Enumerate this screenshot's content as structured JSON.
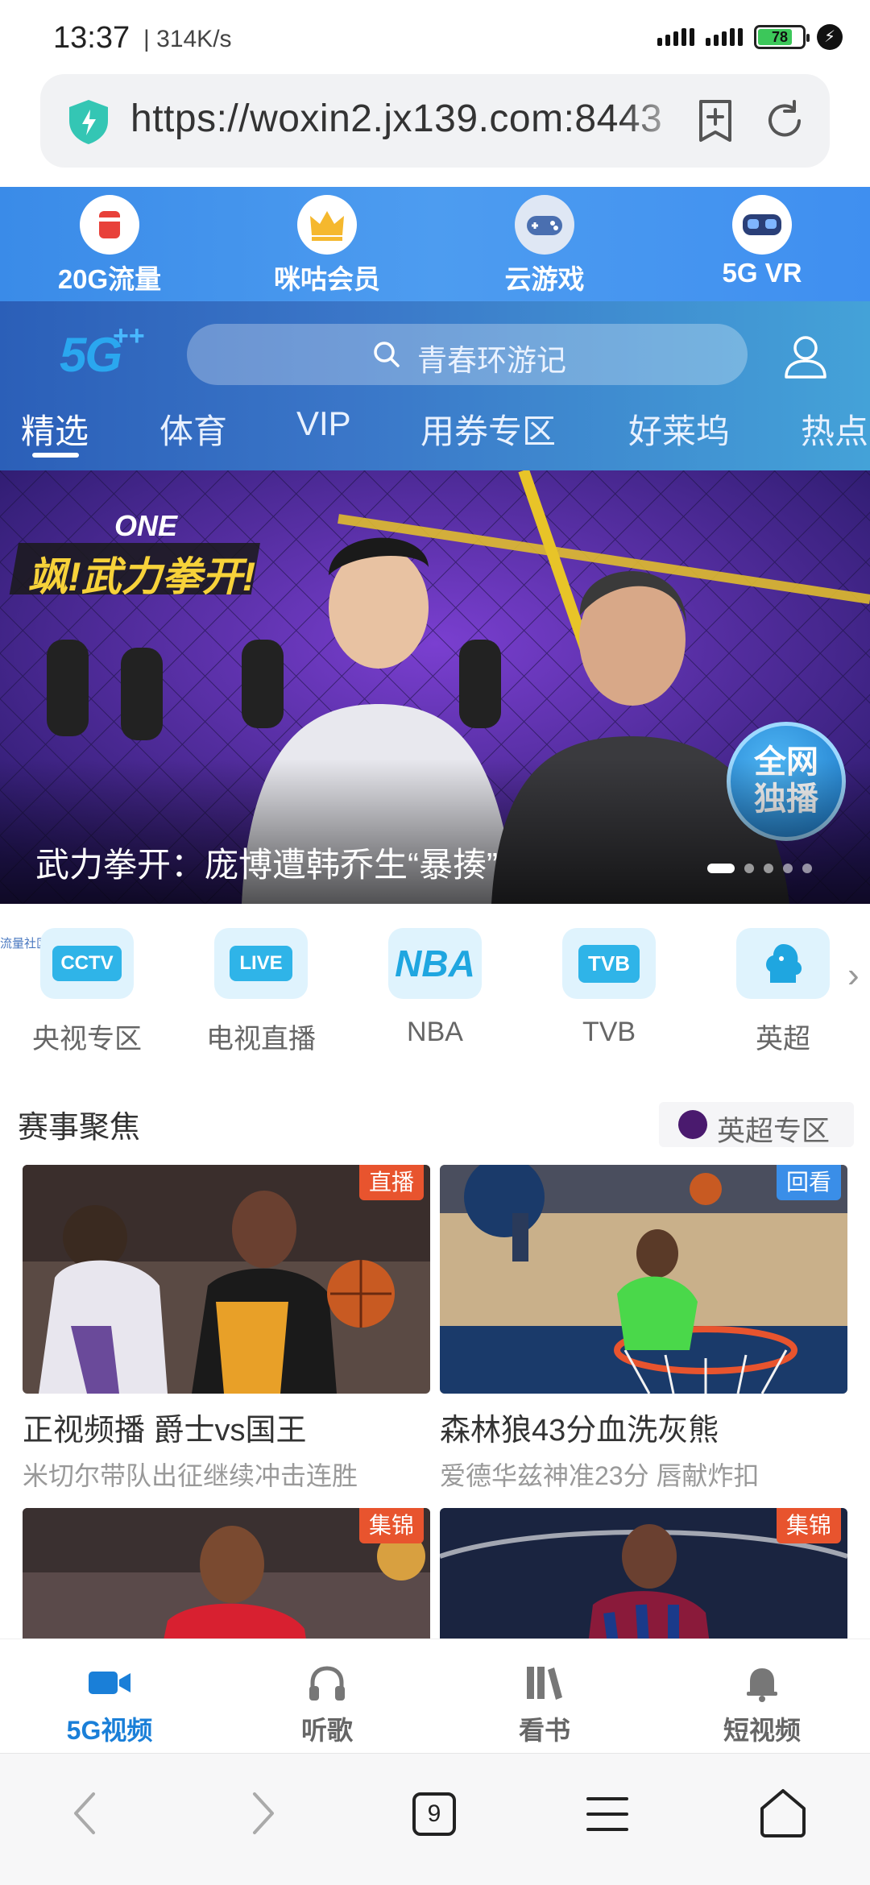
{
  "status_bar": {
    "time": "13:37",
    "speed": "| 314K/s",
    "battery": "78"
  },
  "url_bar": {
    "url": "https://woxin2.jx139.com:8443"
  },
  "quick_links": [
    {
      "label": "20G流量",
      "icon": "data-cup-icon"
    },
    {
      "label": "咪咕会员",
      "icon": "crown-icon"
    },
    {
      "label": "云游戏",
      "icon": "gamepad-icon"
    },
    {
      "label": "5G VR",
      "icon": "vr-goggles-icon"
    }
  ],
  "header": {
    "logo": "5G",
    "logo_sup": "++",
    "search_placeholder": "青春环游记",
    "tabs": [
      "精选",
      "体育",
      "VIP",
      "用券专区",
      "好莱坞",
      "热点"
    ],
    "active_tab": "精选"
  },
  "banner": {
    "caption": "武力拳开：庞博遭韩乔生“暴揍”",
    "show_logo": "ONE",
    "show_title": "飒!武力拳开!",
    "badge": "全网独播",
    "badge_line1": "全网",
    "badge_line2": "独播",
    "slide_count": 5,
    "active_slide": 1
  },
  "channel_tag": "流量社区",
  "channels": [
    {
      "label": "央视专区",
      "icon_text": "CCTV"
    },
    {
      "label": "电视直播",
      "icon_text": "LIVE"
    },
    {
      "label": "NBA",
      "icon_text": "NBA"
    },
    {
      "label": "TVB",
      "icon_text": "TVB"
    },
    {
      "label": "英超",
      "icon_text": ""
    }
  ],
  "events": {
    "title": "赛事聚焦",
    "premier_link": "英超专区",
    "cards": [
      {
        "badge": "直播",
        "title": "正视频播 爵士vs国王",
        "subtitle": "米切尔带队出征继续冲击连胜"
      },
      {
        "badge": "回看",
        "title": "森林狼43分血洗灰熊",
        "subtitle": "爱德华兹神准23分 唇献炸扣"
      },
      {
        "badge": "集锦",
        "title": "",
        "subtitle": ""
      },
      {
        "badge": "集锦",
        "title": "",
        "subtitle": ""
      }
    ]
  },
  "bottom_nav": [
    {
      "label": "5G视频",
      "icon": "video-camera-icon",
      "active": true
    },
    {
      "label": "听歌",
      "icon": "headphones-icon",
      "active": false
    },
    {
      "label": "看书",
      "icon": "books-icon",
      "active": false
    },
    {
      "label": "短视频",
      "icon": "bell-icon",
      "active": false
    }
  ],
  "browser_bar": {
    "tab_count": "9"
  },
  "colors": {
    "accent": "#1a7fd8",
    "header_blue": "#3a8be8",
    "live_badge": "#e8542e",
    "replay_badge": "#3a8ee8"
  }
}
